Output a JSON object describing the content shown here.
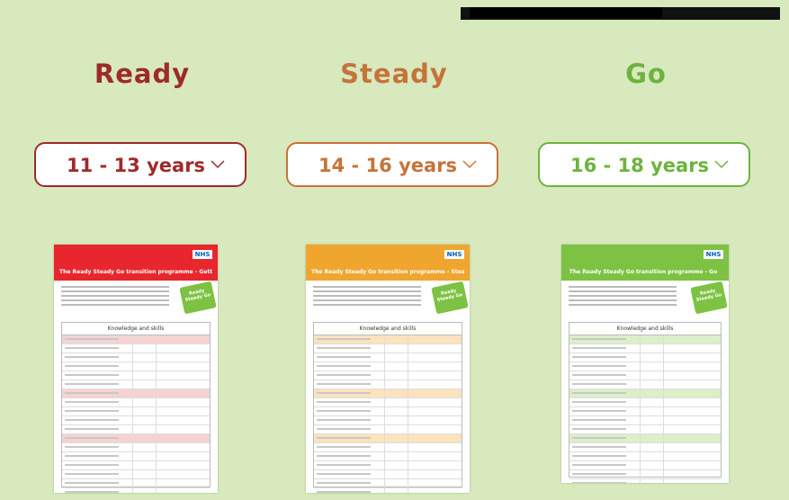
{
  "columns": [
    {
      "heading": "Ready",
      "color": "#9e2a2b",
      "select_value": "11 - 13 years",
      "doc_color": "#e8262d",
      "doc_title": "The Ready Steady Go transition programme - Getting Ready",
      "row_tint": "#f6d3d3"
    },
    {
      "heading": "Steady",
      "color": "#c6733a",
      "select_value": "14 - 16 years",
      "doc_color": "#f0a52f",
      "doc_title": "The Ready Steady Go transition programme - Steady",
      "row_tint": "#fbe3bd"
    },
    {
      "heading": "Go",
      "color": "#6db33f",
      "select_value": "16 - 18 years",
      "doc_color": "#7dc242",
      "doc_title": "The Ready Steady Go transition programme - Go",
      "row_tint": "#dcefc9"
    }
  ],
  "doc_common": {
    "logo": "NHS",
    "table_header": "Knowledge and skills",
    "badge": "Ready Steady Go"
  },
  "icons": {
    "dropdown": "chevron-down-icon"
  }
}
